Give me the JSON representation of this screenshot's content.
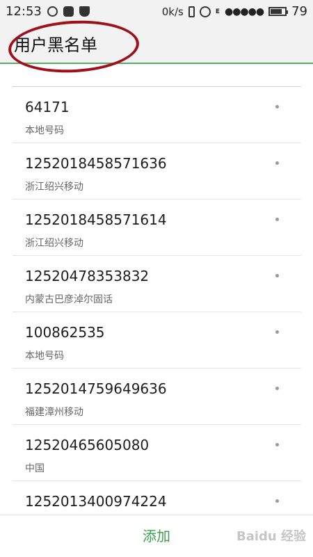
{
  "status_bar": {
    "time": "12:53",
    "data_rate": "0k/s",
    "network": "E",
    "signal": "●●●●●",
    "battery_pct": "79",
    "battery_level": 0.79,
    "left_icons": [
      "q-icon",
      "message-icon",
      "shield-icon"
    ],
    "right_icons": [
      "vibrate-icon",
      "alarm-icon",
      "battery-icon"
    ]
  },
  "header": {
    "title": "用户黑名单"
  },
  "blacklist": [
    {
      "number": "64171",
      "location": "本地号码"
    },
    {
      "number": "1252018458571636",
      "location": "浙江绍兴移动"
    },
    {
      "number": "1252018458571614",
      "location": "浙江绍兴移动"
    },
    {
      "number": "12520478353832",
      "location": "内蒙古巴彦淖尔固话"
    },
    {
      "number": "100862535",
      "location": "本地号码"
    },
    {
      "number": "1252014759649636",
      "location": "福建漳州移动"
    },
    {
      "number": "12520465605080",
      "location": "中国"
    },
    {
      "number": "1252013400974224",
      "location": ""
    }
  ],
  "bottom": {
    "add_label": "添加",
    "watermark": "Baidu 经验"
  },
  "colors": {
    "accent_green": "#3aa04e",
    "annotation_red": "#a0101a"
  }
}
